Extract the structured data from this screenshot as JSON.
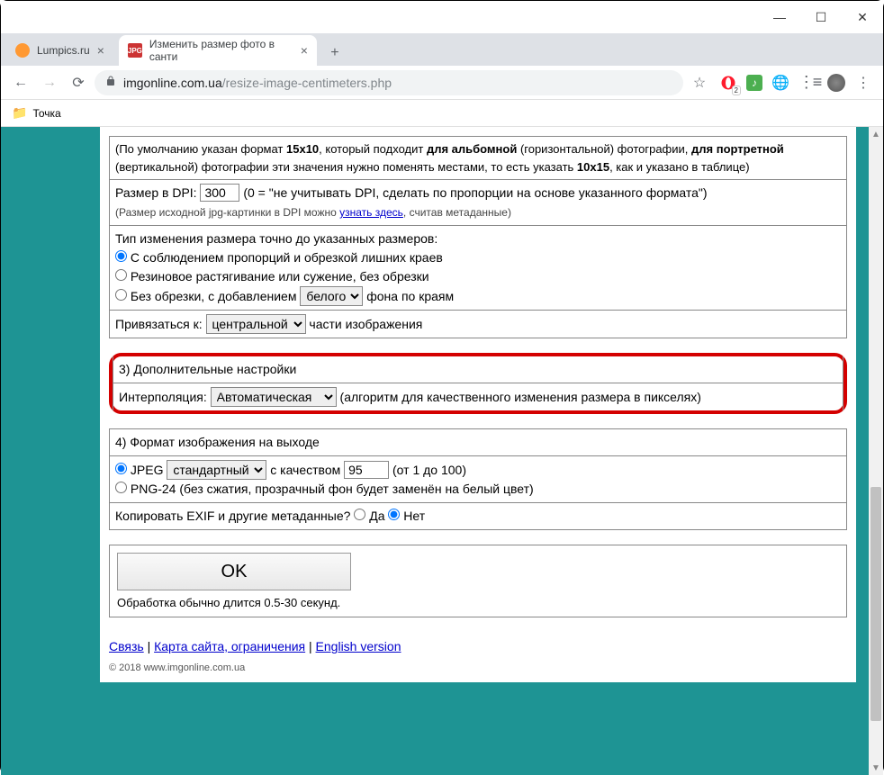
{
  "window": {
    "tabs": [
      {
        "title": "Lumpics.ru",
        "active": false
      },
      {
        "title": "Изменить размер фото в санти",
        "favicon_text": "JPG",
        "active": true
      }
    ]
  },
  "address": {
    "domain": "imgonline.com.ua",
    "path": "/resize-image-centimeters.php",
    "opera_badge": "2"
  },
  "bookmarks": {
    "item1": "Точка"
  },
  "content": {
    "default_note_1": "(По умолчанию указан формат ",
    "default_note_bold1": "15x10",
    "default_note_2": ", который подходит ",
    "default_note_bold2": "для альбомной",
    "default_note_3": " (горизонтальной) фотографии, ",
    "default_note_bold3": "для портретной",
    "default_note_4": " (вертикальной) фотографии эти значения нужно поменять местами, то есть указать ",
    "default_note_bold4": "10x15",
    "default_note_5": ", как и указано в таблице)",
    "dpi_label": "Размер в DPI:",
    "dpi_value": "300",
    "dpi_note": "(0 = \"не учитывать DPI, сделать по пропорции на основе указанного формата\")",
    "dpi_hint_1": "(Размер исходной jpg-картинки в DPI можно ",
    "dpi_hint_link": "узнать здесь",
    "dpi_hint_2": ", считав метаданные)",
    "resize_type_label": "Тип изменения размера точно до указанных размеров:",
    "resize_opt1": "С соблюдением пропорций и обрезкой лишних краев",
    "resize_opt2": "Резиновое растягивание или сужение, без обрезки",
    "resize_opt3_a": "Без обрезки, с добавлением",
    "resize_opt3_select": "белого",
    "resize_opt3_b": "фона по краям",
    "anchor_label_a": "Привязаться к:",
    "anchor_select": "центральной",
    "anchor_label_b": "части изображения",
    "sec3_title": "3) Дополнительные настройки",
    "interp_label": "Интерполяция:",
    "interp_select": "Автоматическая",
    "interp_note": "(алгоритм для качественного изменения размера в пикселях)",
    "sec4_title": "4) Формат изображения на выходе",
    "jpeg_label": "JPEG",
    "jpeg_select": "стандартный",
    "jpeg_quality_a": "с качеством",
    "jpeg_quality_value": "95",
    "jpeg_quality_b": "(от 1 до 100)",
    "png_label": "PNG-24 (без сжатия, прозрачный фон будет заменён на белый цвет)",
    "exif_label": "Копировать EXIF и другие метаданные?",
    "exif_yes": "Да",
    "exif_no": "Нет",
    "ok_btn": "OK",
    "processing_note": "Обработка обычно длится 0.5-30 секунд.",
    "footer_link1": "Связь",
    "footer_link2": "Карта сайта, ограничения",
    "footer_link3": "English version",
    "footer_sep": " | ",
    "copyright": "© 2018 www.imgonline.com.ua"
  }
}
